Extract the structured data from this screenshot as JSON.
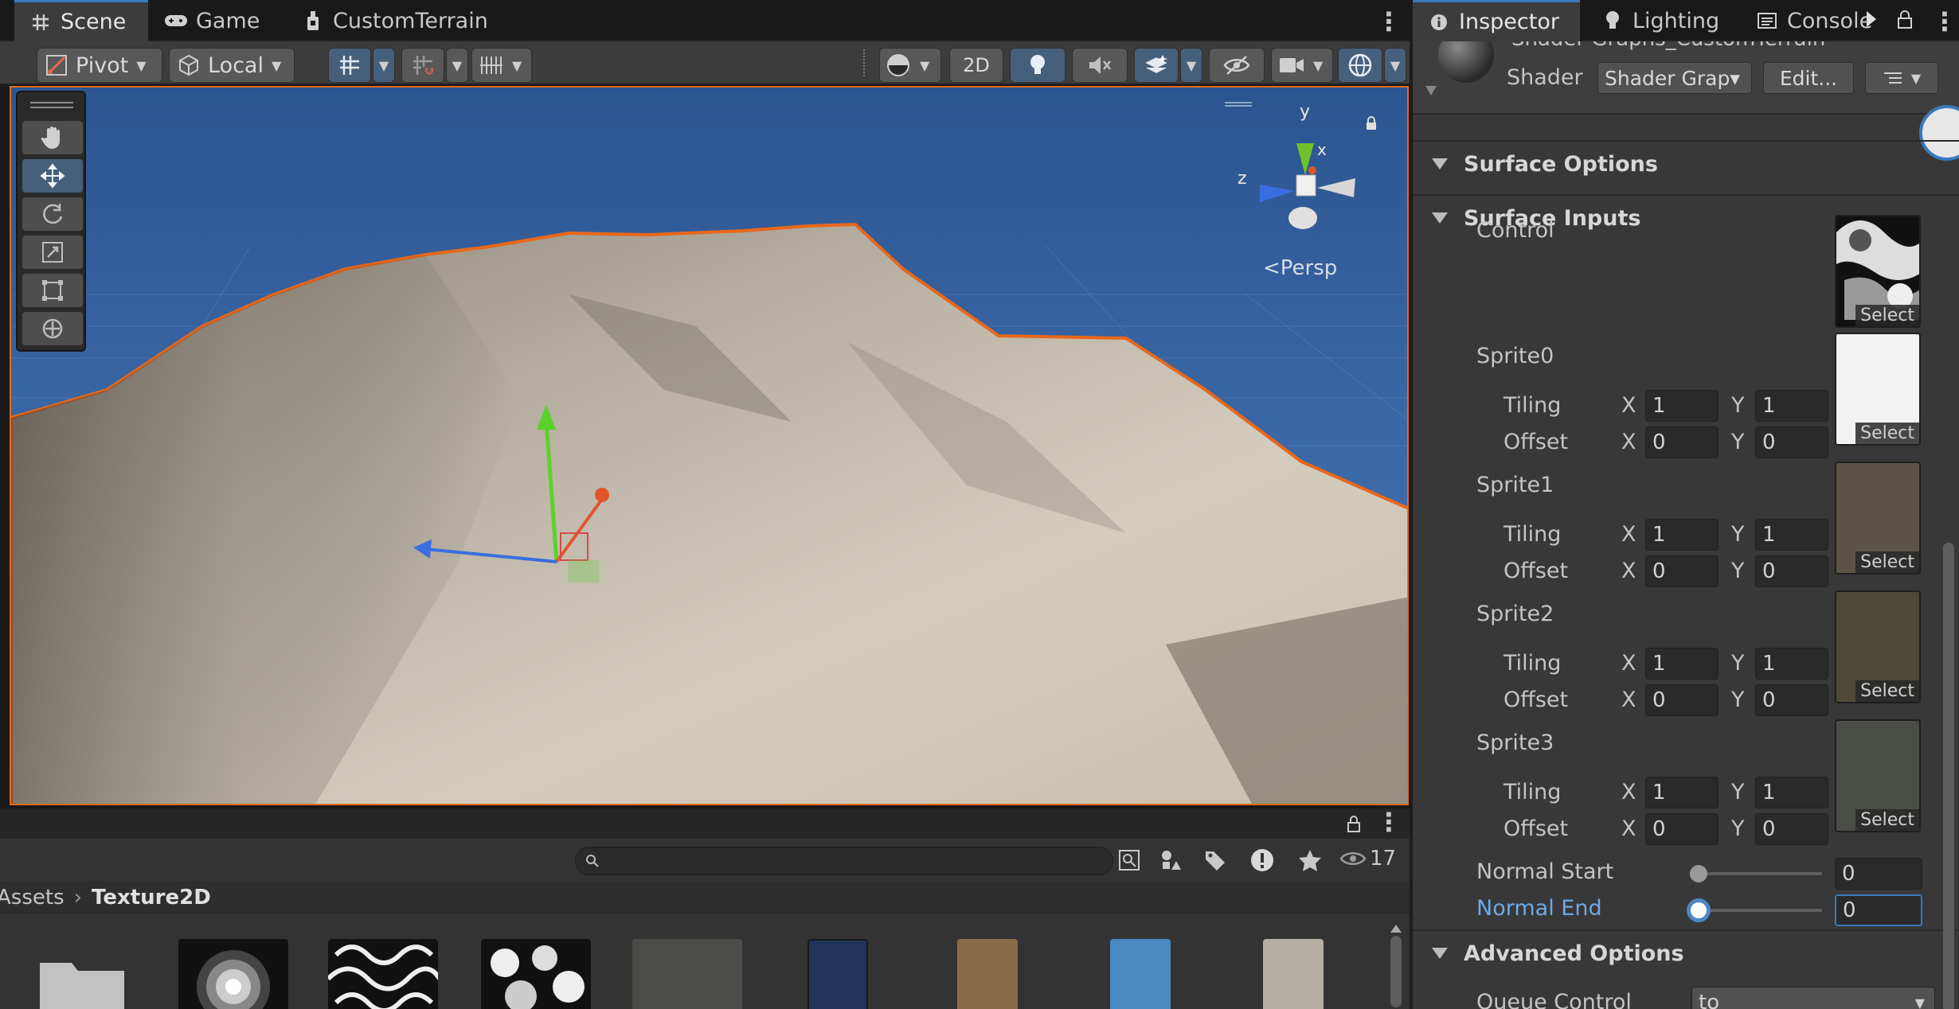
{
  "scene_tabs": [
    {
      "label": "Scene",
      "icon": "grid-icon"
    },
    {
      "label": "Game",
      "icon": "gamepad-icon"
    },
    {
      "label": "CustomTerrain",
      "icon": "terrain-icon"
    }
  ],
  "inspector_tabs": [
    {
      "label": "Inspector",
      "icon": "info-icon"
    },
    {
      "label": "Lighting",
      "icon": "bulb-icon"
    },
    {
      "label": "Console",
      "icon": "console-icon"
    }
  ],
  "toolbar": {
    "pivot": "Pivot",
    "local": "Local",
    "mode_2d": "2D"
  },
  "gizmo": {
    "y": "y",
    "x": "x",
    "z": "z",
    "persp": "Persp"
  },
  "inspector": {
    "shader_name": "Shader Graphs_CustomTerrain",
    "shader_label": "Shader",
    "shader_value": "Shader Grap▾",
    "edit_button": "Edit...",
    "sections": {
      "surface_options": "Surface Options",
      "surface_inputs": "Surface Inputs",
      "advanced_options": "Advanced Options"
    },
    "control_label": "Control",
    "select_label": "Select",
    "tiling_label": "Tiling",
    "offset_label": "Offset",
    "x_label": "X",
    "y_label": "Y",
    "sprites": [
      {
        "name": "Sprite0",
        "tiling_x": "1",
        "tiling_y": "1",
        "offset_x": "0",
        "offset_y": "0",
        "tex": "#f2f2f2"
      },
      {
        "name": "Sprite1",
        "tiling_x": "1",
        "tiling_y": "1",
        "offset_x": "0",
        "offset_y": "0",
        "tex": "#5b5446"
      },
      {
        "name": "Sprite2",
        "tiling_x": "1",
        "tiling_y": "1",
        "offset_x": "0",
        "offset_y": "0",
        "tex": "#4e4837"
      },
      {
        "name": "Sprite3",
        "tiling_x": "1",
        "tiling_y": "1",
        "offset_x": "0",
        "offset_y": "0",
        "tex": "#4a4c46"
      }
    ],
    "normal_start_label": "Normal Start",
    "normal_start_value": "0",
    "normal_end_label": "Normal End",
    "normal_end_value": "0",
    "queue_control_label": "Queue Control",
    "queue_control_value": "to"
  },
  "project": {
    "breadcrumb_root": "Assets",
    "breadcrumb_current": "Texture2D",
    "visible_count": "17",
    "search_placeholder": ""
  },
  "colors": {
    "accent": "#3a79bb",
    "selection": "#e86b1b",
    "sky": "#3e6aa6"
  }
}
